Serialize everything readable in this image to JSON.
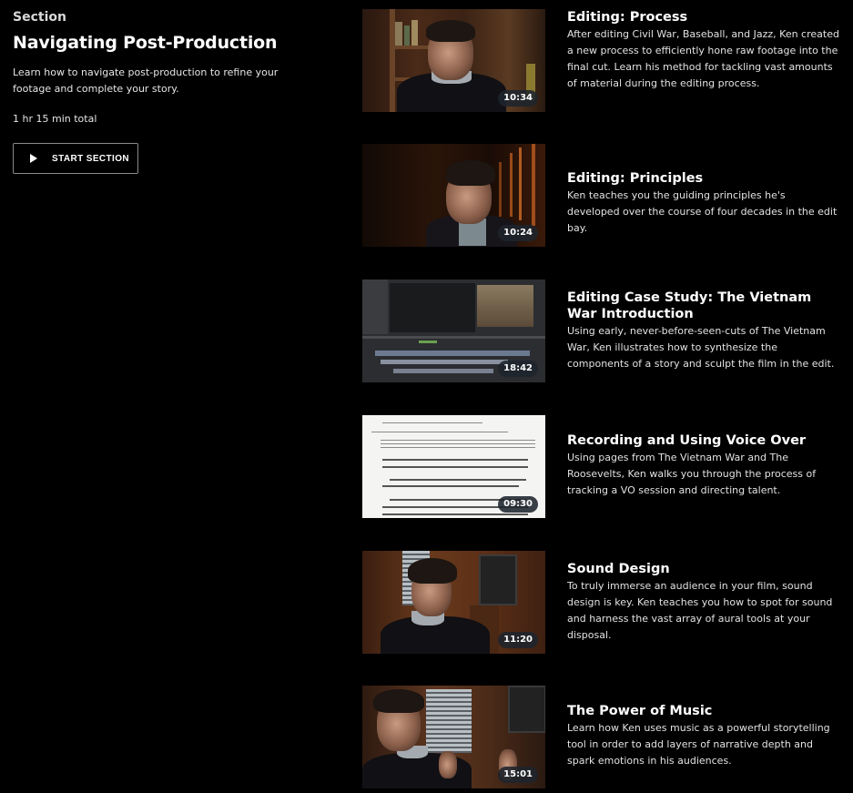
{
  "section": {
    "label": "Section",
    "title": "Navigating Post-Production",
    "description": "Learn how to navigate post-production to refine your footage and complete your story.",
    "total": "1 hr 15 min total",
    "start_button": {
      "icon": "play-icon",
      "label": "START SECTION"
    }
  },
  "lessons": [
    {
      "title": "Editing: Process",
      "description": "After editing Civil War, Baseball, and Jazz, Ken created a new process to efficiently hone raw footage into the final cut. Learn his method for tackling vast amounts of material during the editing process.",
      "duration": "10:34"
    },
    {
      "title": "Editing: Principles",
      "description": "Ken teaches you the guiding principles he's developed over the course of four decades in the edit bay.",
      "duration": "10:24"
    },
    {
      "title": "Editing Case Study: The Vietnam War Introduction",
      "description": "Using early, never-before-seen-cuts of The Vietnam War, Ken illustrates how to synthesize the components of a story and sculpt the film in the edit.",
      "duration": "18:42"
    },
    {
      "title": "Recording and Using Voice Over",
      "description": "Using pages from The Vietnam War and The Roosevelts, Ken walks you through the process of tracking a VO session and directing talent.",
      "duration": "09:30"
    },
    {
      "title": "Sound Design",
      "description": "To truly immerse an audience in your film, sound design is key. Ken teaches you how to spot for sound and harness the vast array of aural tools at your disposal.",
      "duration": "11:20"
    },
    {
      "title": "The Power of Music",
      "description": "Learn how Ken uses music as a powerful storytelling tool in order to add layers of narrative depth and spark emotions in his audiences.",
      "duration": "15:01"
    }
  ]
}
